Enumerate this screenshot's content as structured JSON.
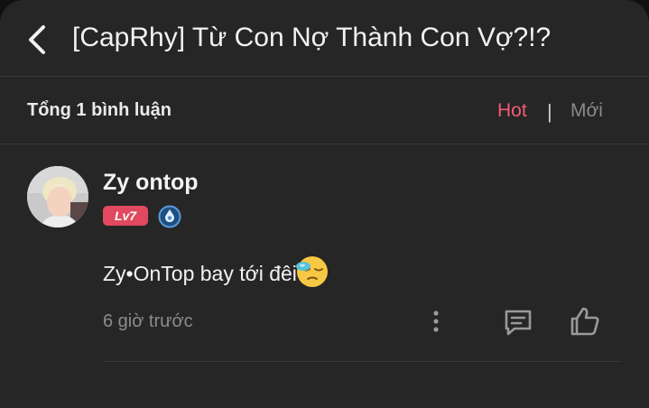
{
  "header": {
    "title": "[CapRhy] Từ Con Nợ Thành Con Vợ?!?"
  },
  "comments_bar": {
    "count_label": "Tổng 1 bình luận",
    "sort_hot": "Hot",
    "sort_separator": "|",
    "sort_new": "Mới",
    "active_sort": "Hot"
  },
  "comment": {
    "username": "Zy ontop",
    "level_badge": "Lv7",
    "text": "Zy•OnTop bay tới đêi",
    "emoji": "sleepy-face-emoji",
    "time": "6 giờ trước"
  },
  "icons": {
    "back": "chevron-left-icon",
    "more": "more-vertical-icon",
    "reply": "reply-comment-icon",
    "like": "thumbs-up-icon",
    "rank": "rank-drop-badge-icon"
  },
  "colors": {
    "background": "#262626",
    "accent": "#f05d73",
    "badge": "#e0495f",
    "muted": "#8c8c8c",
    "text": "#f2f2f2"
  }
}
